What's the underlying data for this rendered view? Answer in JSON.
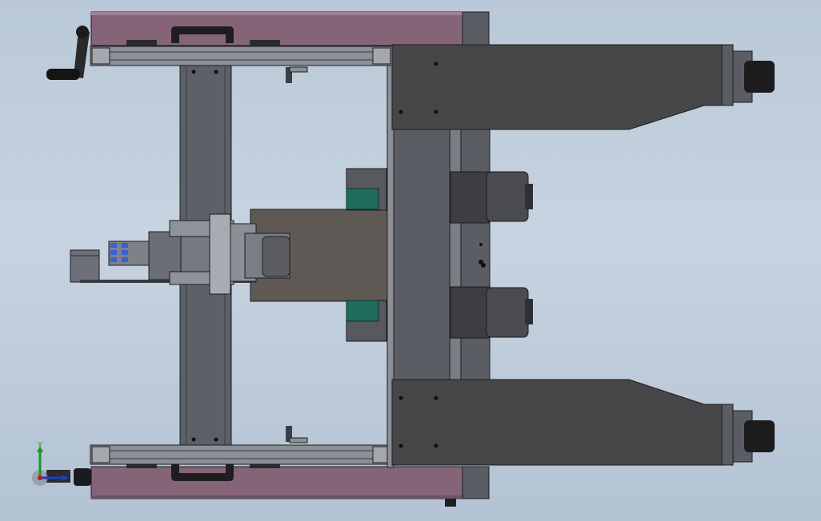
{
  "viewport": {
    "background_top": "#b9c8d8",
    "background_bottom": "#b3c3d4"
  },
  "colors": {
    "frame_purple": "#866478",
    "frame_purple_dark": "#6e5164",
    "steel_dark": "#474749",
    "steel_mid": "#5b5d64",
    "steel_light": "#8b8f96",
    "column_grey": "#5c6068",
    "plate_brown": "#5e5955",
    "motor_dark": "#3d3e41",
    "green_roller": "#1f6b5d",
    "connector_blue": "#3a5fd0",
    "edge": "#1c1c1e"
  },
  "icons": {
    "handle": "crank-handle-icon",
    "wheel": "caster-wheel-icon",
    "motor": "motor-icon"
  },
  "triad": {
    "y_axis_label": "Y",
    "y_color": "#1a9b1a",
    "x_color": "#1d3fbf",
    "z_color": "#c01818"
  }
}
